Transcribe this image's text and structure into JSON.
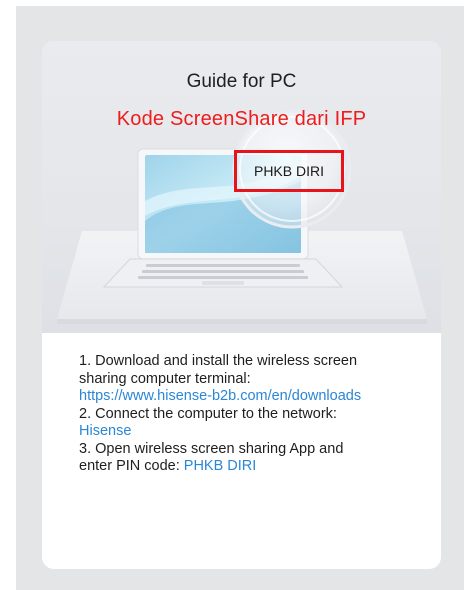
{
  "guide": {
    "title": "Guide for PC",
    "overlay_caption": "Kode ScreenShare dari IFP",
    "pin_code": "PHKB DIRI"
  },
  "steps": {
    "step1_line1": "1. Download and install the wireless screen",
    "step1_line2": "sharing computer terminal:",
    "download_url": "https://www.hisense-b2b.com/en/downloads",
    "step2_line1": "2. Connect the computer to the network:",
    "network_name": "Hisense",
    "step3_line1": "3. Open wireless screen sharing App and",
    "step3_line2_prefix": "enter PIN code: ",
    "pin_code": "PHKB DIRI"
  },
  "colors": {
    "link": "#2a86d6",
    "annotation_red": "#e8141b",
    "background": "#e4e5e7"
  },
  "icons": {
    "illustration": "laptop-magnifier-illustration"
  }
}
